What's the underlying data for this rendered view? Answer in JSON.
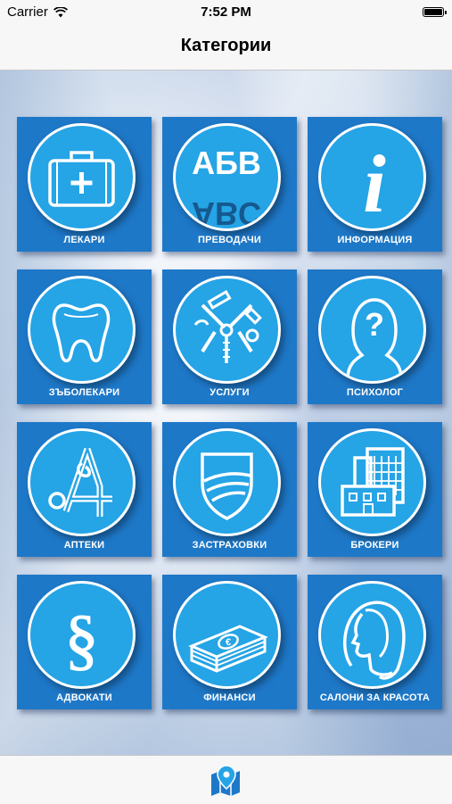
{
  "status_bar": {
    "carrier": "Carrier",
    "time": "7:52 PM"
  },
  "nav": {
    "title": "Категории"
  },
  "categories": [
    {
      "label": "ЛЕКАРИ",
      "icon": "first-aid-kit-icon"
    },
    {
      "label": "ПРЕВОДАЧИ",
      "icon": "translation-abc-icon",
      "icon_text_top": "АБВ",
      "icon_text_bottom": "ABC"
    },
    {
      "label": "ИНФОРМАЦИЯ",
      "icon": "info-icon",
      "icon_text": "i"
    },
    {
      "label": "ЗЪБОЛЕКАРИ",
      "icon": "tooth-icon"
    },
    {
      "label": "УСЛУГИ",
      "icon": "tools-icon"
    },
    {
      "label": "ПСИХОЛОГ",
      "icon": "head-question-icon",
      "icon_text": "?"
    },
    {
      "label": "АПТЕКИ",
      "icon": "pharmacy-icon"
    },
    {
      "label": "ЗАСТРАХОВКИ",
      "icon": "insurance-shield-icon"
    },
    {
      "label": "БРОКЕРИ",
      "icon": "buildings-icon"
    },
    {
      "label": "АДВОКАТИ",
      "icon": "section-sign-icon",
      "icon_text": "§"
    },
    {
      "label": "ФИНАНСИ",
      "icon": "money-stack-icon",
      "icon_text": "€"
    },
    {
      "label": "САЛОНИ ЗА КРАСОТА",
      "icon": "woman-profile-icon"
    }
  ],
  "tab_bar": {
    "icon": "map-pin-icon"
  },
  "colors": {
    "tile": "#1e78c8",
    "circle": "#25a4e6",
    "nav_bg": "#f7f7f7"
  }
}
